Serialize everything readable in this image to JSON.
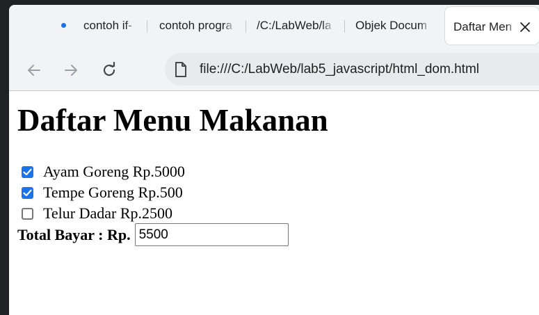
{
  "browser": {
    "tabs": [
      {
        "label": "contoh if-"
      },
      {
        "label": "contoh progra"
      },
      {
        "label": "/C:/LabWeb/la"
      },
      {
        "label": "Objek Docum"
      }
    ],
    "active_tab": {
      "label": "Daftar Men"
    },
    "address_bar": {
      "url": "file:///C:/LabWeb/lab5_javascript/html_dom.html"
    },
    "colors": {
      "accent": "#1a73e8",
      "tabstrip": "#f1f3f4",
      "omnibox": "#e8eaed"
    }
  },
  "page": {
    "title": "Daftar Menu Makanan",
    "items": [
      {
        "label": "Ayam Goreng Rp.5000",
        "checked": true
      },
      {
        "label": "Tempe Goreng Rp.500",
        "checked": true
      },
      {
        "label": "Telur Dadar Rp.2500",
        "checked": false
      }
    ],
    "total_label": "Total Bayar : Rp.",
    "total_value": "5500"
  }
}
